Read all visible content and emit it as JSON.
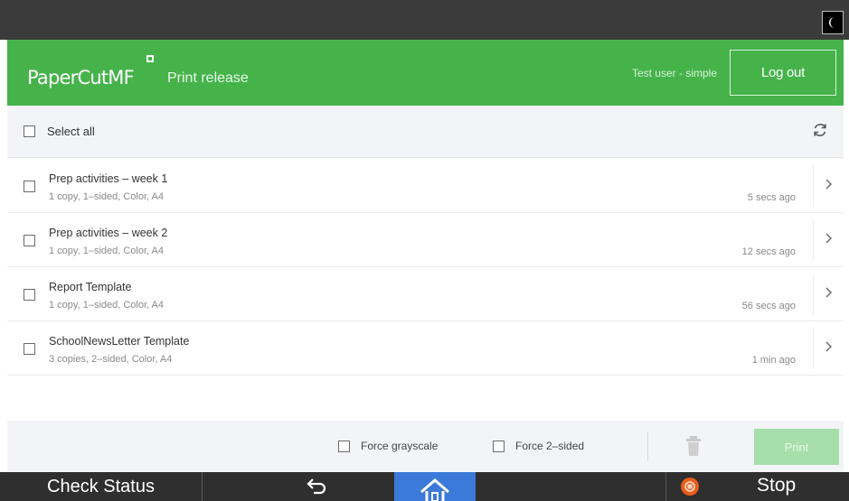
{
  "header": {
    "logo_text": "PaperCut",
    "logo_suffix": "MF",
    "title": "Print release",
    "user": "Test user - simple",
    "logout_label": "Log out"
  },
  "select_all": {
    "label": "Select all"
  },
  "jobs": [
    {
      "name": "Prep activities – week 1",
      "details": "1 copy, 1–sided, Color, A4",
      "time": "5 secs ago"
    },
    {
      "name": "Prep activities – week 2",
      "details": "1 copy, 1–sided, Color, A4",
      "time": "12 secs ago"
    },
    {
      "name": "Report Template",
      "details": "1 copy, 1–sided, Color, A4",
      "time": "56 secs ago"
    },
    {
      "name": "SchoolNewsLetter Template",
      "details": "3 copies, 2–sided, Color, A4",
      "time": "1 min ago"
    }
  ],
  "bottom": {
    "force_grayscale_label": "Force grayscale",
    "force_2sided_label": "Force 2–sided",
    "print_label": "Print"
  },
  "system_bar": {
    "check_status_label": "Check Status",
    "stop_label": "Stop"
  },
  "colors": {
    "brand_green": "#45b34a",
    "print_disabled": "#a6dfa9",
    "home_blue": "#3b7ad8",
    "stop_orange": "#e85c1c"
  },
  "icons": [
    "night-mode-icon",
    "refresh-icon",
    "chevron-right-icon",
    "trash-icon",
    "back-arrow-icon",
    "home-icon",
    "stop-icon"
  ]
}
